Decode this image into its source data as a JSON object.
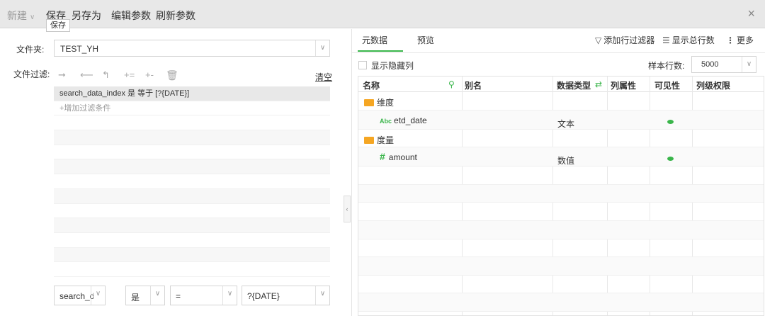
{
  "toolbar": {
    "new_label": "新建",
    "save_label": "保存",
    "save_as_label": "另存为",
    "edit_params_label": "编辑参数",
    "refresh_params_label": "刷新参数",
    "tooltip": "保存",
    "close_symbol": "×"
  },
  "left": {
    "folder_label": "文件夹:",
    "folder_value": "TEST_YH",
    "filter_label": "文件过滤:",
    "clear_label": "清空",
    "filter_rows": [
      "search_data_index 是 等于 [?{DATE}]",
      "+增加过滤条件"
    ],
    "condition": {
      "field": "search_data_ir",
      "op1": "是",
      "op2": "=",
      "value": "?{DATE}"
    }
  },
  "right": {
    "tabs": [
      "元数据",
      "预览"
    ],
    "actions": {
      "add_filter": "添加行过滤器",
      "show_total": "显示总行数",
      "more": "更多"
    },
    "show_hidden_label": "显示隐藏列",
    "sample_label": "样本行数:",
    "sample_value": "5000",
    "columns": [
      "名称",
      "别名",
      "数据类型",
      "列属性",
      "可见性",
      "列级权限"
    ],
    "rows": [
      {
        "kind": "group",
        "name": "维度"
      },
      {
        "kind": "field",
        "icon": "Abc",
        "name": "etd_date",
        "type": "文本",
        "visible": true
      },
      {
        "kind": "group",
        "name": "度量"
      },
      {
        "kind": "field",
        "icon": "#",
        "name": "amount",
        "type": "数值",
        "visible": true
      }
    ]
  },
  "colors": {
    "accent": "#39b54a",
    "folder": "#f5a623"
  }
}
